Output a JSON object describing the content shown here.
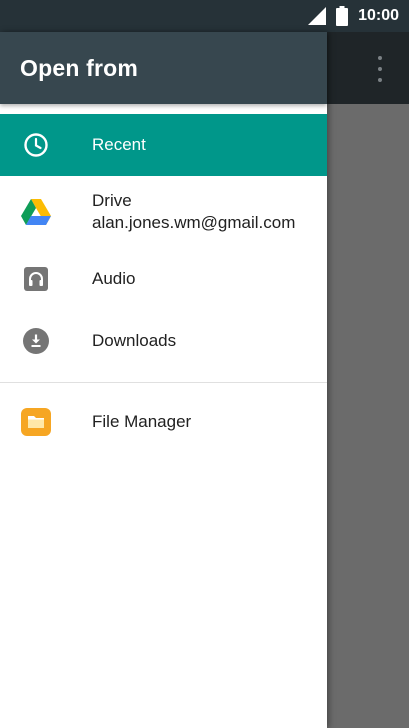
{
  "status_bar": {
    "time": "10:00",
    "signal_icon": "signal-icon",
    "battery_icon": "battery-icon"
  },
  "toolbar": {
    "overflow_icon": "overflow-menu-icon"
  },
  "drawer": {
    "title": "Open from",
    "selected_color": "#00978a",
    "header_color": "#37474f",
    "items": [
      {
        "label": "Recent",
        "icon": "clock-icon",
        "selected": true
      },
      {
        "label": "Drive",
        "sublabel": "alan.jones.wm@gmail.com",
        "icon": "google-drive-icon",
        "selected": false
      },
      {
        "label": "Audio",
        "icon": "headphones-icon",
        "selected": false
      },
      {
        "label": "Downloads",
        "icon": "download-icon",
        "selected": false
      }
    ],
    "extra_items": [
      {
        "label": "File Manager",
        "icon": "folder-icon",
        "selected": false
      }
    ]
  }
}
